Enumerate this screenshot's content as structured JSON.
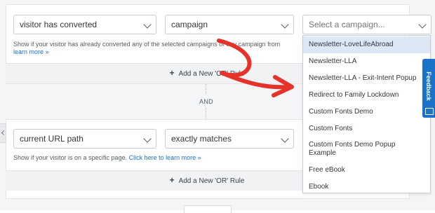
{
  "rule1": {
    "condition_select": "visitor has converted",
    "type_select": "campaign",
    "campaign_select_placeholder": "Select a campaign...",
    "helper_text": "Show if your visitor has already converted any of the selected campaigns or any campaign from",
    "helper_link": "learn more »",
    "add_or_label": "Add a New 'OR' Rule"
  },
  "connector": {
    "label": "AND"
  },
  "rule2": {
    "condition_select": "current URL path",
    "match_select": "exactly matches",
    "helper_text": "Show if your visitor is on a specific page.",
    "helper_link": "Click here to learn more »",
    "add_or_label": "Add a New 'OR' Rule"
  },
  "dropdown": {
    "options": [
      "Newsletter-LoveLifeAbroad",
      "Newsletter-LLA",
      "Newsletter-LLA - Exit-Intent Popup",
      "Redirect to Family Lockdown",
      "Custom Fonts Demo",
      "Custom Fonts",
      "Custom Fonts Demo Popup Example",
      "Free eBook",
      "Ebook"
    ],
    "highlighted_index": 0
  },
  "feedback_tab": {
    "label": "Feedback"
  },
  "colors": {
    "accent": "#1a73c9",
    "annotation_arrow": "#e5332a",
    "highlight": "#dce8f6"
  },
  "icons": {
    "plus": "plus-icon",
    "chevron": "chevron-down-icon",
    "back": "chevron-left-icon",
    "feedback": "chat-icon"
  }
}
